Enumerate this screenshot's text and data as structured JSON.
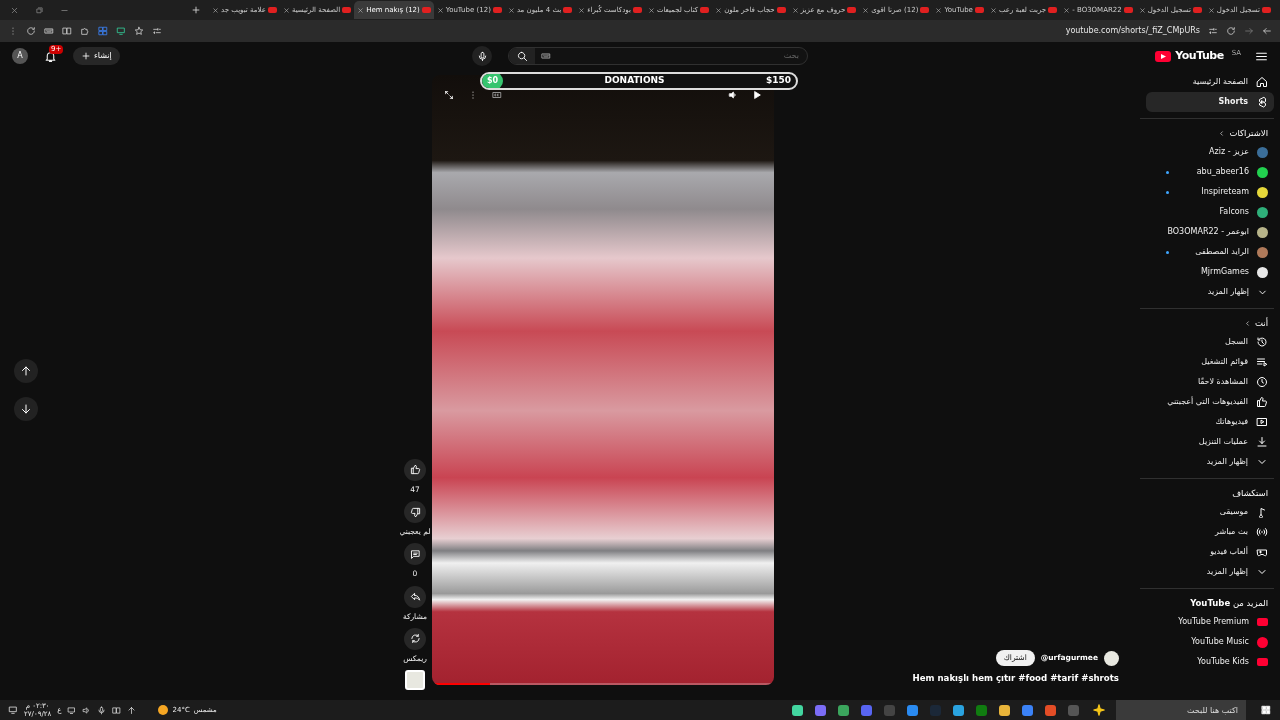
{
  "browser": {
    "tabs": [
      {
        "title": "تسجيل الدخول",
        "selected": false
      },
      {
        "title": "تسجيل الدخول",
        "selected": false
      },
      {
        "title": "BO3OMAR22 -",
        "selected": false
      },
      {
        "title": "جربت لعبة رعب",
        "selected": false
      },
      {
        "title": "YouTube",
        "selected": false
      },
      {
        "title": "(12) صرنا اقوى",
        "selected": false
      },
      {
        "title": "حروف مع عزيز",
        "selected": false
      },
      {
        "title": "حجاب فاخر ملون",
        "selected": false
      },
      {
        "title": "كتاب لجميعات",
        "selected": false
      },
      {
        "title": "بودكاست كُبراء",
        "selected": false
      },
      {
        "title": "بث 4 مليون مد",
        "selected": false
      },
      {
        "title": "(12) YouTube",
        "selected": false
      },
      {
        "title": "(12) Hem nakış",
        "selected": true
      },
      {
        "title": "الصفحة الرئيسية",
        "selected": false
      },
      {
        "title": "علامة تبويب جد",
        "selected": false
      }
    ],
    "address": "youtube.com/shorts/_fiZ_CMpURs"
  },
  "masthead": {
    "logo": "YouTube",
    "region": "SA",
    "search": {
      "placeholder": "بحث"
    },
    "create": "إنشاء",
    "notifications": "9+",
    "avatar": "A"
  },
  "sidebar": {
    "main": [
      {
        "label": "الصفحة الرئيسية",
        "selected": false
      },
      {
        "label": "Shorts",
        "selected": true
      }
    ],
    "subscriptions": {
      "title": "الاشتراكات",
      "items": [
        {
          "label": "عزيز - Aziz",
          "new": false,
          "color": "#3b6e99"
        },
        {
          "label": "abu_abeer16",
          "new": true,
          "color": "#22d14f"
        },
        {
          "label": "Inspireteam",
          "new": true,
          "color": "#e6d83a"
        },
        {
          "label": "Falcons",
          "new": false,
          "color": "#2fb07a"
        },
        {
          "label": "ابوعمر - BO3OMAR22",
          "new": false,
          "color": "#b8b48a"
        },
        {
          "label": "الرايد المصطفى",
          "new": true,
          "color": "#b07a5a"
        },
        {
          "label": "MjrmGames",
          "new": false,
          "color": "#e8e8e8"
        }
      ],
      "more": "إظهار المزيد"
    },
    "you": {
      "title": "أنت",
      "items": [
        "السجل",
        "قوائم التشغيل",
        "المشاهدة لاحقًا",
        "الفيديوهات التي أعجبتني",
        "فيديوهاتك",
        "عمليات التنزيل",
        "إظهار المزيد"
      ]
    },
    "explore": {
      "title": "استكشاف",
      "items": [
        "موسيقى",
        "بث مباشر",
        "ألعاب فيديو",
        "إظهار المزيد"
      ]
    },
    "more_from": {
      "title": "المزيد من **YouTube**",
      "items": [
        "YouTube Premium",
        "YouTube Music",
        "YouTube Kids"
      ]
    }
  },
  "donations": {
    "raised": "$0",
    "title": "DONATIONS",
    "goal": "$150"
  },
  "actions": [
    "47",
    "لم يعجبني",
    "0",
    "مشاركة",
    "ريمكس"
  ],
  "short": {
    "progress": {
      "level": 0.17
    },
    "channel": "@urfagurmee",
    "subscribe": "اشتراك",
    "title": "Hem nakışlı hem çıtır #food #tarif #shrots"
  },
  "taskbar": {
    "search": {
      "placeholder": "اكتب هنا للبحث"
    },
    "weather": {
      "temperature": "24°C",
      "condition": "مشمس"
    },
    "language": "ع",
    "time": "٠٢:٣٠ م",
    "date": "٢٧/٠٩/٢٨"
  }
}
